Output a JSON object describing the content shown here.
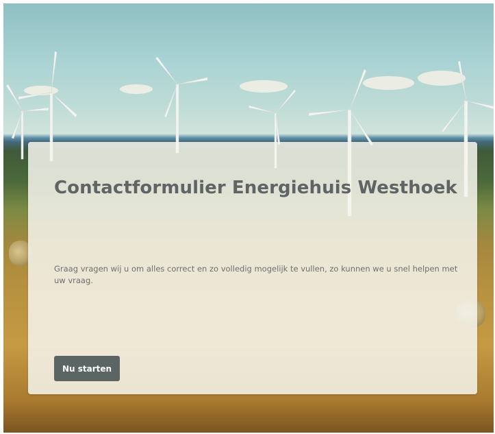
{
  "form": {
    "title": "Contactformulier Energiehuis Westhoek",
    "intro": "Graag vragen wij u om alles correct en zo volledig mogelijk te vullen, zo kunnen we u snel helpen met uw vraag.",
    "start_button_label": "Nu starten"
  },
  "background": {
    "image": "wind-turbines-landscape",
    "accent_color": "#5b6664"
  }
}
